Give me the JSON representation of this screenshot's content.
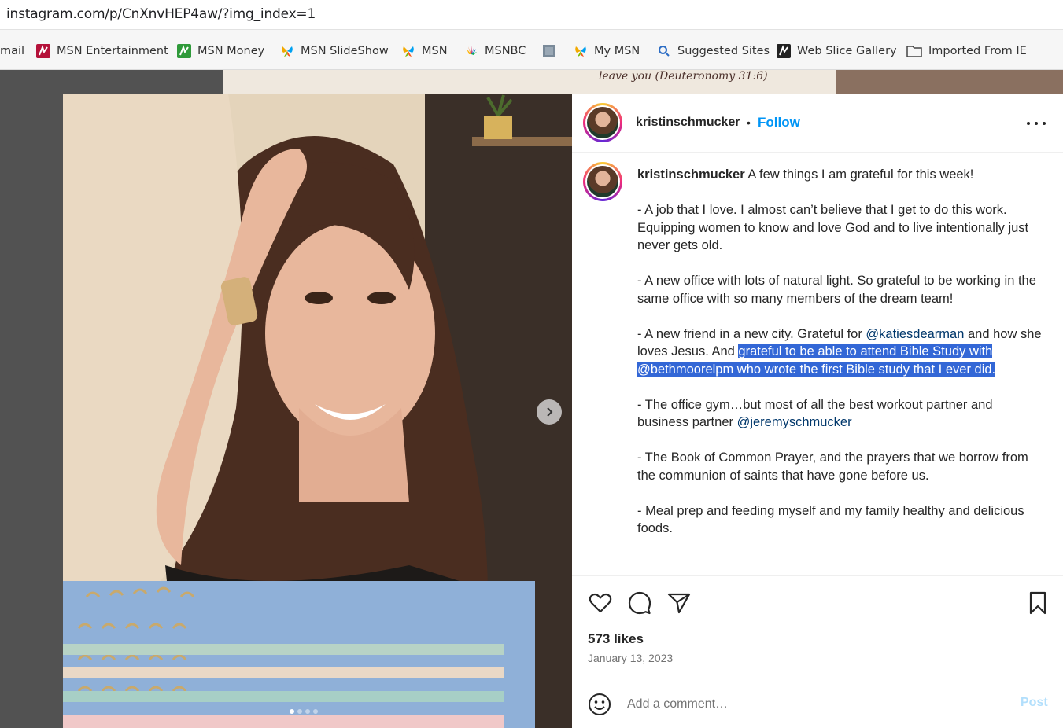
{
  "browser": {
    "url": "instagram.com/p/CnXnvHEP4aw/?img_index=1"
  },
  "bookmarks": [
    {
      "label": "mail",
      "icon": "msn-mail-icon"
    },
    {
      "label": "MSN Entertainment",
      "icon": "msn-entertainment-icon"
    },
    {
      "label": "MSN Money",
      "icon": "msn-money-icon"
    },
    {
      "label": "MSN SlideShow",
      "icon": "msn-butterfly-icon"
    },
    {
      "label": "MSN",
      "icon": "msn-butterfly-icon"
    },
    {
      "label": "MSNBC",
      "icon": "nbc-peacock-icon"
    },
    {
      "label": "",
      "icon": "blank-page-icon"
    },
    {
      "label": "My MSN",
      "icon": "msn-butterfly-icon"
    },
    {
      "label": "Suggested Sites",
      "icon": "search-icon"
    },
    {
      "label": "Web Slice Gallery",
      "icon": "web-slice-icon"
    },
    {
      "label": "Imported From IE",
      "icon": "folder-icon"
    }
  ],
  "background_text": "leave you (Deuteronomy 31:6)",
  "post": {
    "username": "kristinschmucker",
    "follow_label": "Follow",
    "separator": "•",
    "caption_intro": "A few things I am grateful for this week!",
    "para1": "- A job that I love. I almost can’t believe that I get to do this work. Equipping women to know and love God and to live intentionally just never gets old.",
    "para2": "- A new office with lots of natural light. So grateful to be working in the same office with so many members of the dream team!",
    "para3_a": "- A new friend in a new city. Grateful for ",
    "para3_mention": "@katiesdearman",
    "para3_b": " and how she loves Jesus. And ",
    "para3_highlight": "grateful to be able to attend Bible Study with @bethmoorelpm who wrote the first Bible study that I ever did.",
    "para4_a": "- The office gym…but most of all the best workout partner and business partner ",
    "para4_mention": "@jeremyschmucker",
    "para5": "- The Book of Common Prayer, and the prayers that we borrow from the communion of saints that have gone before us.",
    "para6": "- Meal prep and feeding myself and my family healthy and delicious foods.",
    "likes": "573 likes",
    "date": "January 13, 2023",
    "comment_placeholder": "Add a comment…",
    "post_label": "Post"
  },
  "carousel": {
    "current_index": 1,
    "total": 4
  },
  "colors": {
    "follow": "#0095f6",
    "mention": "#00376b",
    "selection": "#3367d6",
    "post_disabled": "#b2dffc"
  }
}
